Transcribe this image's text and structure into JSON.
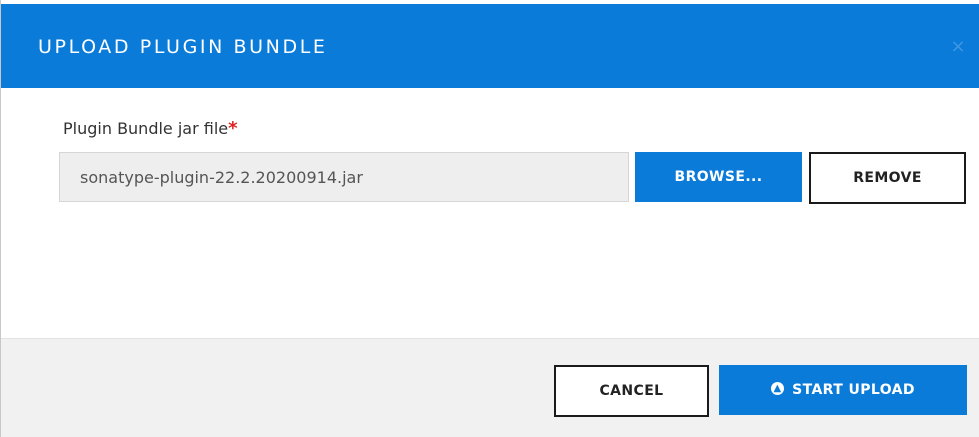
{
  "dialog": {
    "title": "UPLOAD PLUGIN BUNDLE",
    "close_glyph": "×"
  },
  "form": {
    "field_label": "Plugin Bundle jar file",
    "required_marker": "*",
    "file_value": "sonatype-plugin-22.2.20200914.jar",
    "browse_label": "BROWSE...",
    "remove_label": "REMOVE"
  },
  "footer": {
    "cancel_label": "CANCEL",
    "start_upload_label": "START UPLOAD",
    "upload_icon_glyph": "▲"
  },
  "colors": {
    "primary": "#0b7bd9",
    "required": "#e02020",
    "footer_bg": "#f1f1f1",
    "input_bg": "#eeeeee"
  },
  "icons": {
    "close": "close-icon",
    "upload": "arrow-up-circle-icon"
  }
}
